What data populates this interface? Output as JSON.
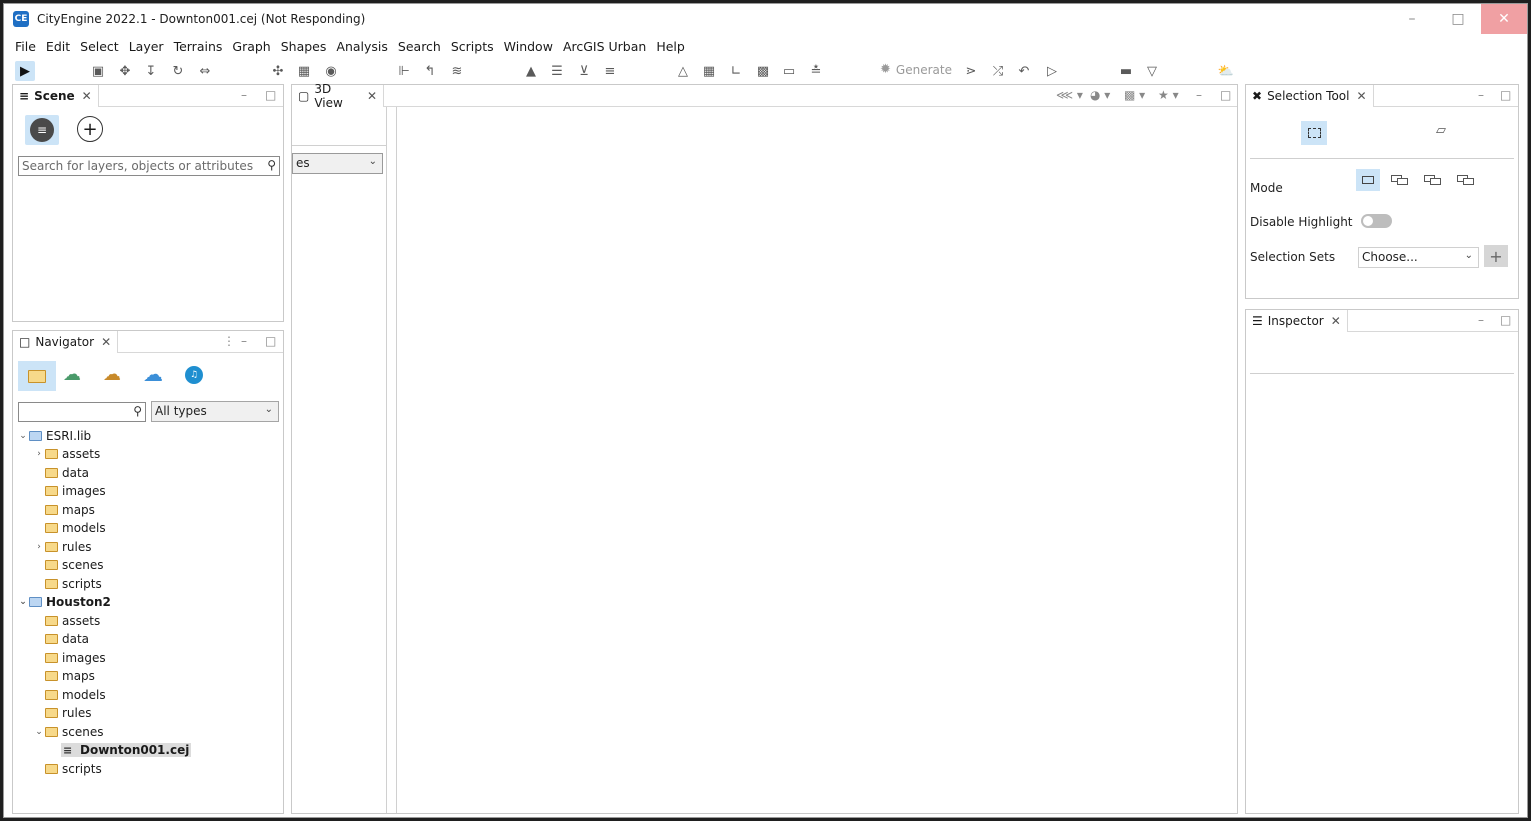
{
  "window": {
    "title": "CityEngine 2022.1 - Downton001.cej (Not Responding)",
    "logo_text": "CE"
  },
  "menu": [
    "File",
    "Edit",
    "Select",
    "Layer",
    "Terrains",
    "Graph",
    "Shapes",
    "Analysis",
    "Search",
    "Scripts",
    "Window",
    "ArcGIS Urban",
    "Help"
  ],
  "toolbar": {
    "generate_label": "Generate"
  },
  "scene_panel": {
    "tab_label": "Scene",
    "search_placeholder": "Search for layers, objects or attributes"
  },
  "navigator_panel": {
    "tab_label": "Navigator",
    "filter_value": "All types",
    "tree": [
      {
        "label": "ESRI.lib",
        "level": 0,
        "expanded": true,
        "type": "project"
      },
      {
        "label": "assets",
        "level": 1,
        "expandable": true,
        "type": "folder"
      },
      {
        "label": "data",
        "level": 1,
        "type": "folder"
      },
      {
        "label": "images",
        "level": 1,
        "type": "folder"
      },
      {
        "label": "maps",
        "level": 1,
        "type": "folder"
      },
      {
        "label": "models",
        "level": 1,
        "type": "folder"
      },
      {
        "label": "rules",
        "level": 1,
        "expandable": true,
        "type": "folder"
      },
      {
        "label": "scenes",
        "level": 1,
        "type": "folder"
      },
      {
        "label": "scripts",
        "level": 1,
        "type": "folder"
      },
      {
        "label": "Houston2",
        "level": 0,
        "expanded": true,
        "type": "project",
        "bold": true
      },
      {
        "label": "assets",
        "level": 1,
        "type": "folder"
      },
      {
        "label": "data",
        "level": 1,
        "type": "folder"
      },
      {
        "label": "images",
        "level": 1,
        "type": "folder"
      },
      {
        "label": "maps",
        "level": 1,
        "type": "folder"
      },
      {
        "label": "models",
        "level": 1,
        "type": "folder"
      },
      {
        "label": "rules",
        "level": 1,
        "type": "folder"
      },
      {
        "label": "scenes",
        "level": 1,
        "expanded": true,
        "type": "folder"
      },
      {
        "label": "Downton001.cej",
        "level": 2,
        "type": "scene",
        "selected": true
      },
      {
        "label": "scripts",
        "level": 1,
        "type": "folder"
      }
    ]
  },
  "view_panel": {
    "tab_label": "3D View",
    "side_select_value": "es"
  },
  "selection_tool": {
    "tab_label": "Selection Tool",
    "mode_label": "Mode",
    "disable_highlight_label": "Disable Highlight",
    "selection_sets_label": "Selection Sets",
    "selection_sets_value": "Choose..."
  },
  "inspector": {
    "tab_label": "Inspector"
  },
  "colors": {
    "accent": "#cce4f7",
    "close_button": "#f0a0a3",
    "brand": "#1f6fc4"
  }
}
